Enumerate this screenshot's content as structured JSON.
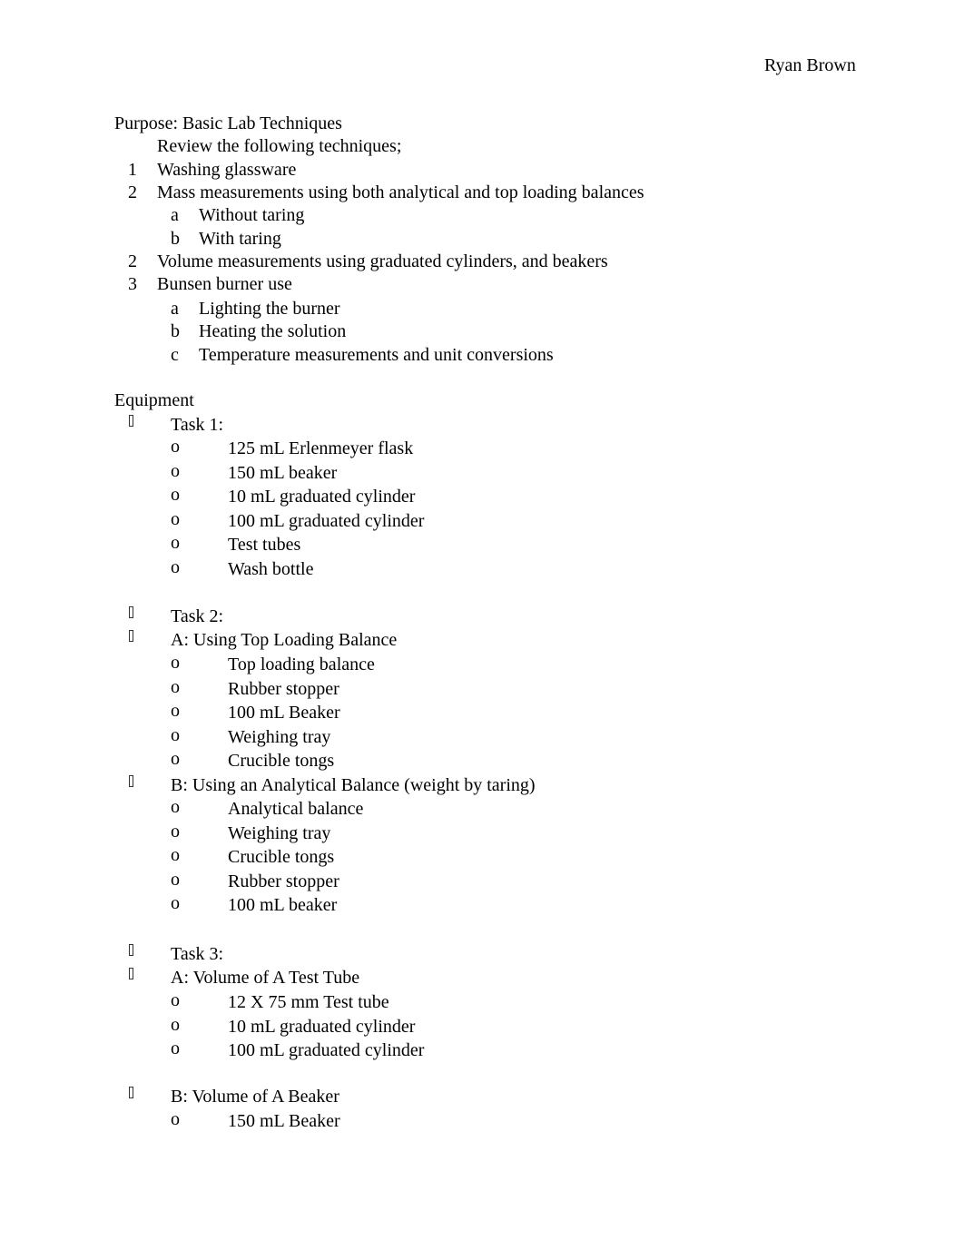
{
  "header": {
    "author": "Ryan Brown"
  },
  "purpose": {
    "title": "Purpose: Basic Lab Techniques",
    "intro": "Review the following techniques;",
    "items": [
      {
        "marker": "1",
        "text": "Washing glassware",
        "sub": []
      },
      {
        "marker": "2",
        "text": "Mass measurements using both analytical and top loading balances",
        "sub": [
          {
            "marker": "a",
            "text": "Without taring"
          },
          {
            "marker": "b",
            "text": "With taring"
          }
        ]
      },
      {
        "marker": "2",
        "text": "Volume measurements using graduated cylinders, and beakers",
        "sub": []
      },
      {
        "marker": "3",
        "text": "Bunsen burner use",
        "sub": [
          {
            "marker": "a",
            "text": "Lighting the burner"
          },
          {
            "marker": "b",
            "text": "Heating the solution"
          },
          {
            "marker": "c",
            "text": "Temperature measurements and unit conversions"
          }
        ]
      }
    ]
  },
  "equipment": {
    "title": "Equipment",
    "sub_bullet": "o",
    "task1": {
      "label": "Task 1:",
      "items": [
        "125 mL Erlenmeyer flask",
        "150 mL beaker",
        "10 mL graduated cylinder",
        "100 mL graduated cylinder",
        "Test tubes",
        "Wash bottle"
      ]
    },
    "task2": {
      "label": "Task 2:",
      "a": {
        "label": "A: Using Top Loading Balance",
        "items": [
          "Top loading balance",
          "Rubber stopper",
          "100 mL Beaker",
          "Weighing tray",
          "Crucible tongs"
        ]
      },
      "b": {
        "label": "B: Using an Analytical Balance (weight by taring)",
        "items": [
          "Analytical balance",
          "Weighing tray",
          "Crucible tongs",
          "Rubber stopper",
          "100 mL beaker"
        ]
      }
    },
    "task3": {
      "label": "Task 3:",
      "a": {
        "label": "A: Volume of A Test Tube",
        "items": [
          "12 X 75 mm Test tube",
          "10 mL graduated cylinder",
          "100 mL graduated cylinder"
        ]
      },
      "b": {
        "label": "B: Volume of A Beaker",
        "items": [
          "150 mL Beaker"
        ]
      }
    }
  }
}
